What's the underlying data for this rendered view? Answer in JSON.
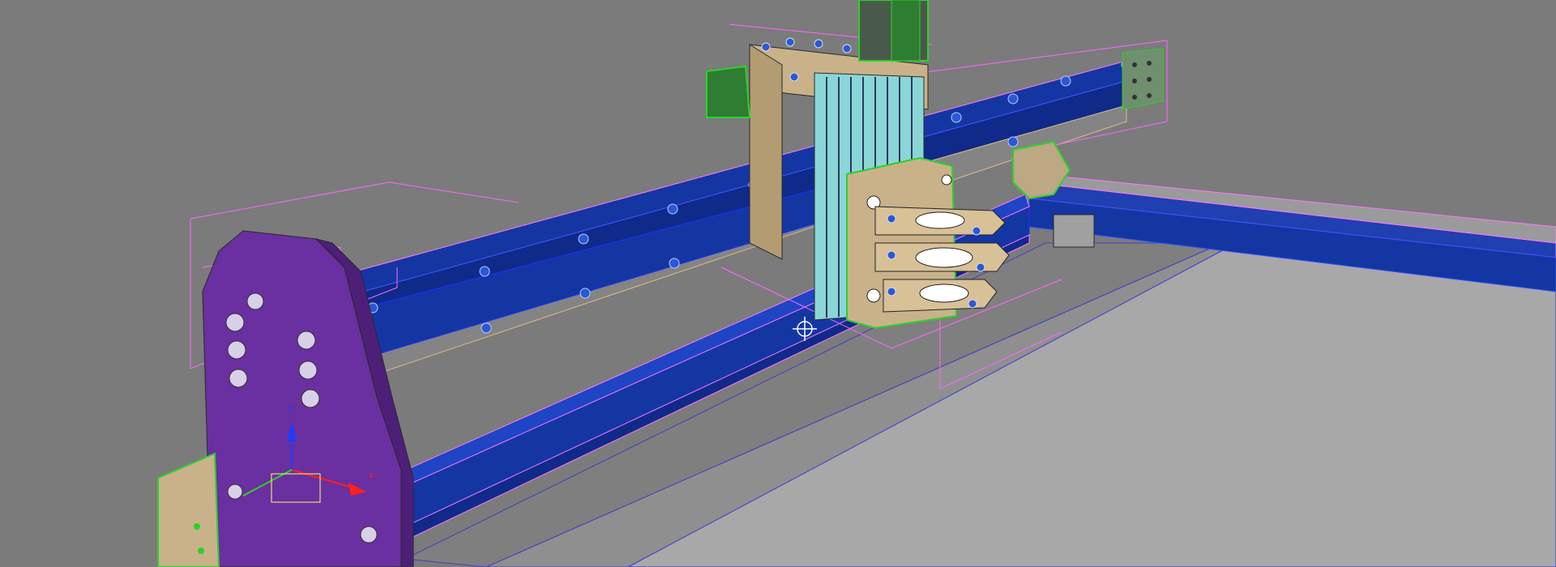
{
  "viewport": {
    "background": "#7b7b7b",
    "view_type": "perspective 3D viewport, shaded with edged faces",
    "selected_object_color": "#ff66ff",
    "gizmo": {
      "label_x": "x",
      "label_z": "z",
      "x_color": "#ff2020",
      "z_color": "#1f3cff",
      "y_color": "#2bd12b"
    }
  },
  "objects": {
    "rail_color": "#1436a3",
    "plate_color": "#c9b28a",
    "side_plate_color": "#6a2fa0",
    "bed_color": "#a8a8a8",
    "motor_color": "#2e7d32",
    "spindle_color": "#8ad6d6"
  }
}
